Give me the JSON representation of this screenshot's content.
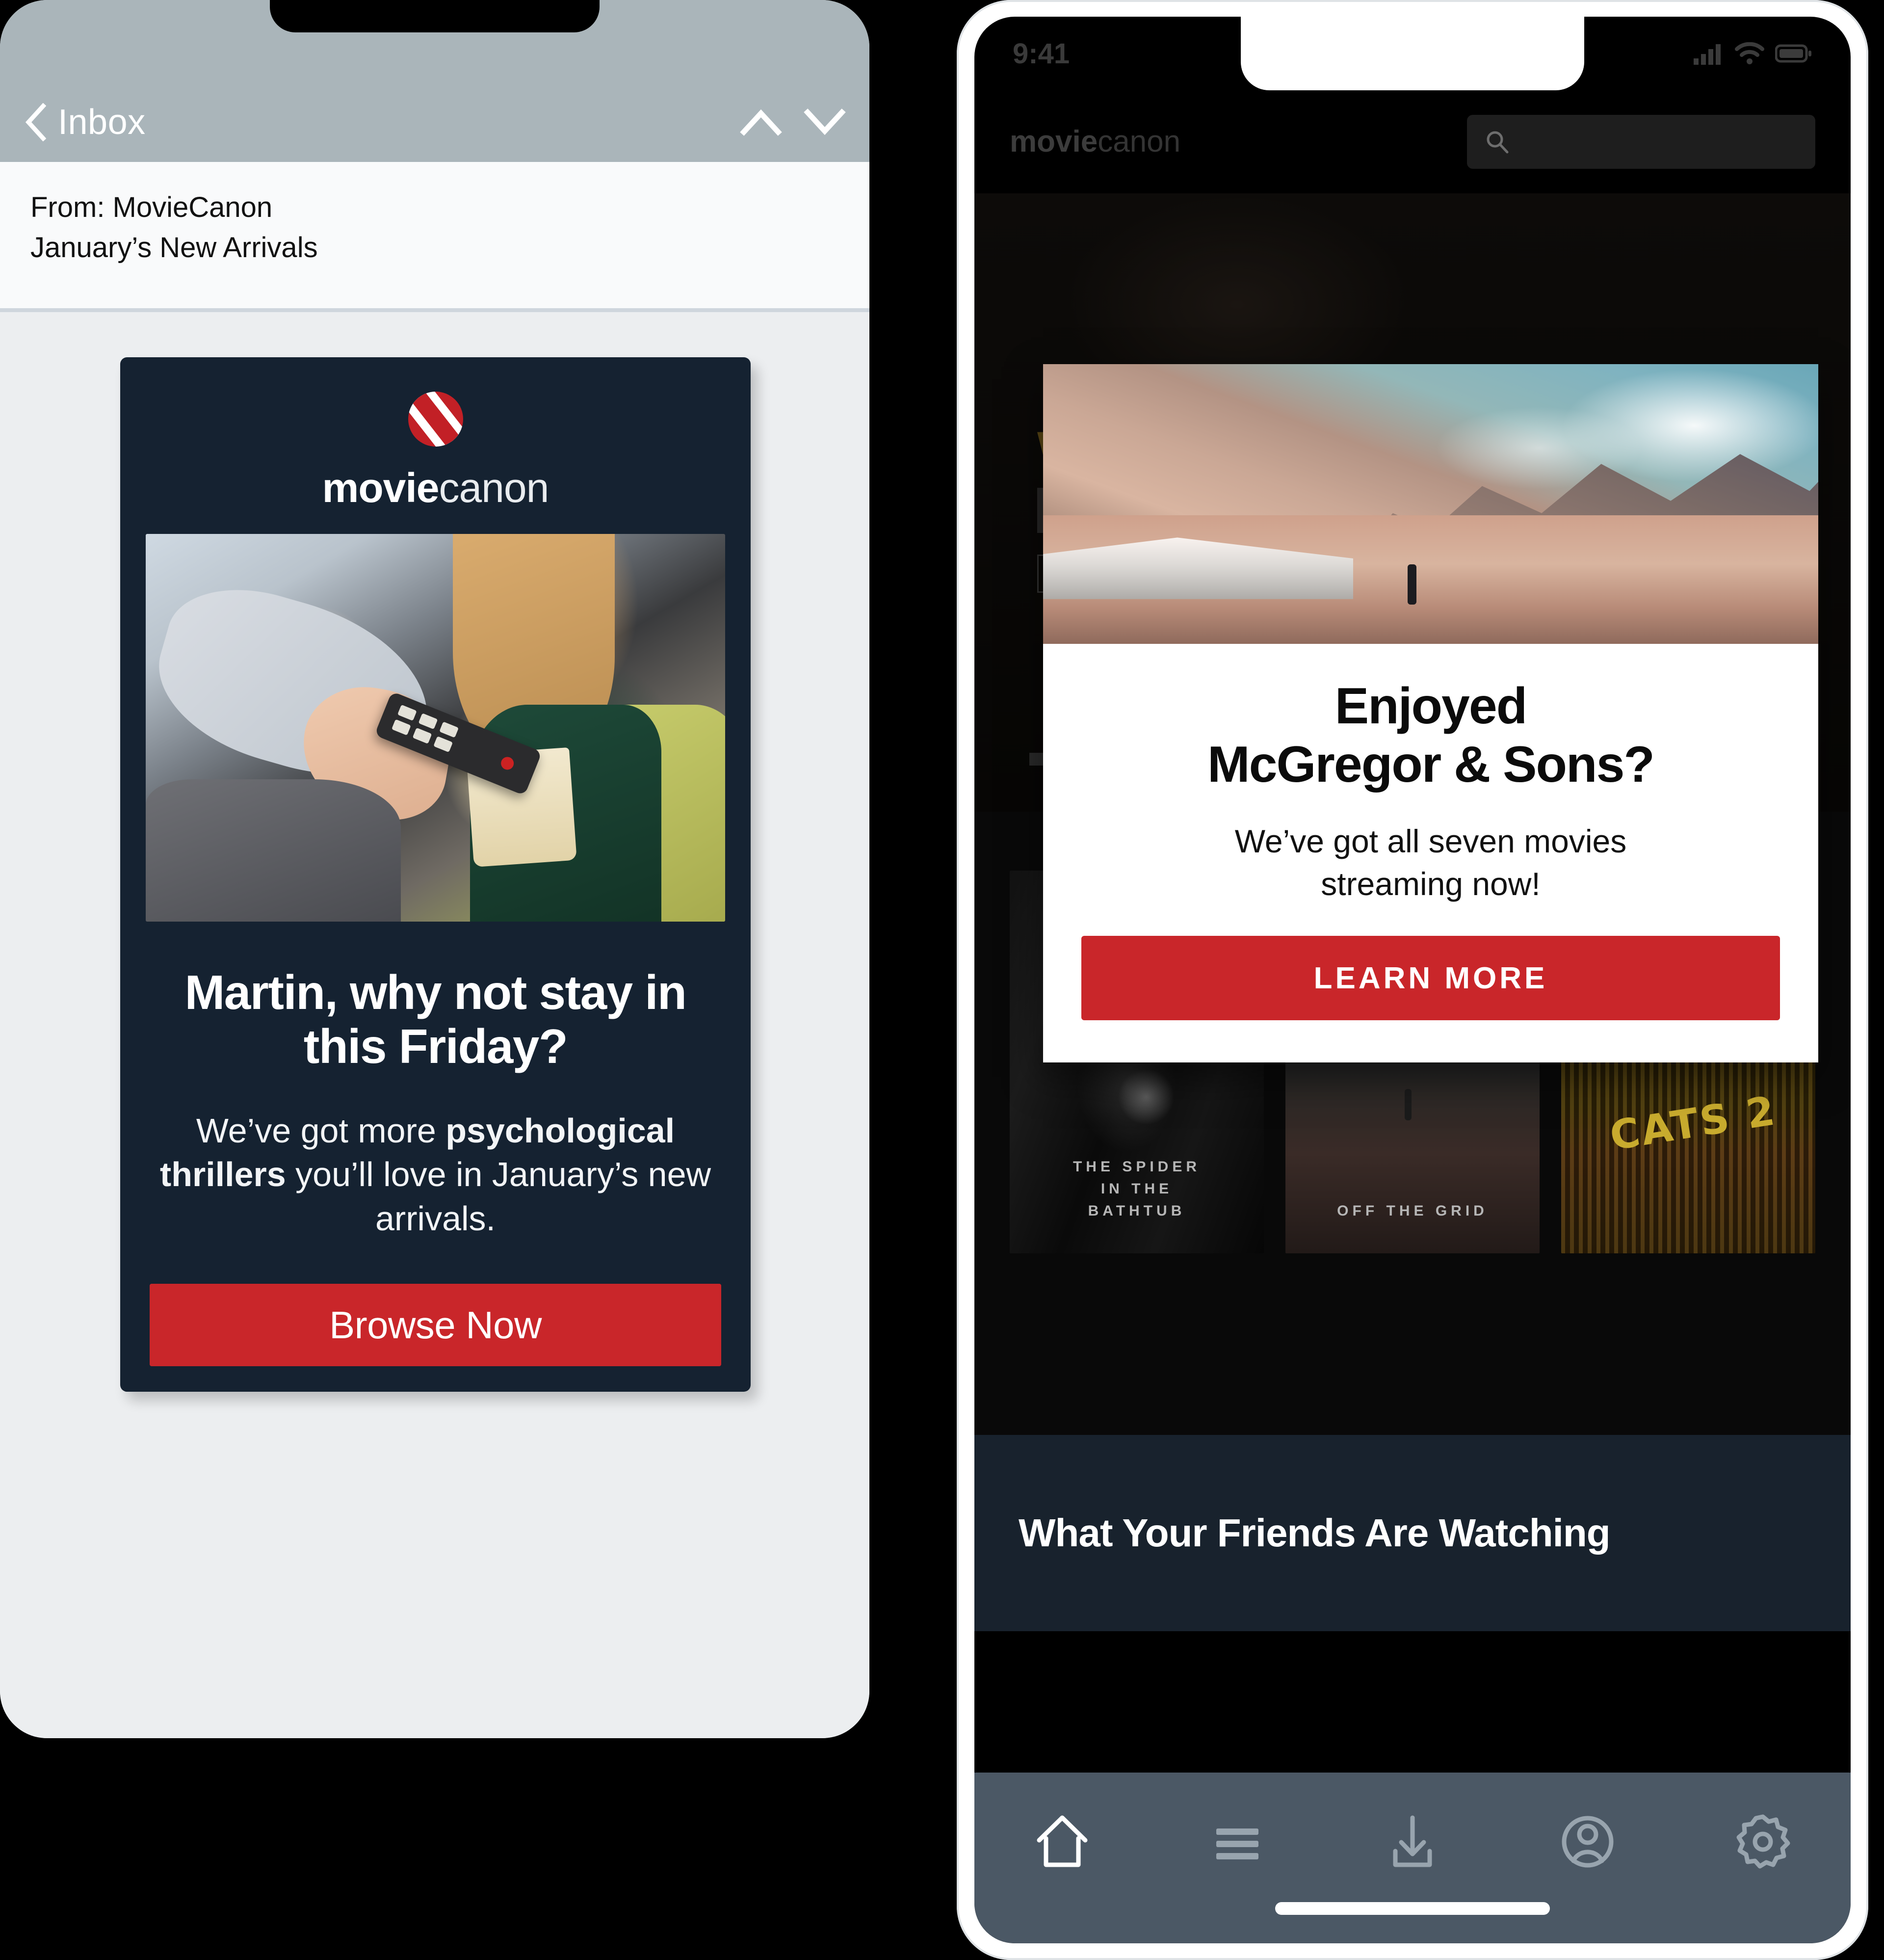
{
  "colors": {
    "brand_red": "#c9262a",
    "email_card_bg": "#152231",
    "mail_topbar": "#aab5ba",
    "tabbar": "#4b5865",
    "friends_strip": "#18222d"
  },
  "email_phone": {
    "topbar": {
      "back_label": "Inbox",
      "back_icon": "chevron-left-icon",
      "prev_icon": "chevron-up-icon",
      "next_icon": "chevron-down-icon"
    },
    "message": {
      "from_line": "From: MovieCanon",
      "subject_line": "January’s New Arrivals"
    },
    "card": {
      "logo_icon": "filmstrip-logo-icon",
      "logo_bold": "movie",
      "logo_light": "canon",
      "hero_alt": "couple-on-couch-with-remote-and-popcorn",
      "headline": "Martin, why not stay in this Friday?",
      "body_before": "We’ve got more ",
      "body_bold": "psychological thrillers",
      "body_after": " you’ll love in January’s new arrivals.",
      "cta_label": "Browse Now"
    }
  },
  "app_phone": {
    "status_bar": {
      "time": "9:41",
      "cellular_icon": "cellular-bars-icon",
      "wifi_icon": "wifi-icon",
      "battery_icon": "battery-icon"
    },
    "header": {
      "logo_bold": "movie",
      "logo_light": "canon",
      "search_icon": "search-icon",
      "search_value": "",
      "search_placeholder": ""
    },
    "background": {
      "banner_title": "W",
      "dimmed": true
    },
    "modal": {
      "hero_alt": "person-walking-on-beach-with-mountains",
      "title_line1": "Enjoyed",
      "title_line2": "McGregor & Sons?",
      "subtitle_line1": "We’ve got all seven movies",
      "subtitle_line2": "streaming now!",
      "cta_label": "LEARN MORE"
    },
    "posters": [
      {
        "title": "THE SPIDER IN THE BATHTUB",
        "lines": [
          "THE SPIDER",
          "IN THE",
          "BATHTUB"
        ]
      },
      {
        "title": "OFF THE GRID",
        "lines": [
          "OFF THE GRID"
        ]
      },
      {
        "title": "CATS 2",
        "lines": [
          "CATS 2"
        ]
      }
    ],
    "section": {
      "title": "What Your Friends Are Watching"
    },
    "tabbar": {
      "items": [
        {
          "name": "home",
          "icon": "home-icon",
          "active": true
        },
        {
          "name": "menu",
          "icon": "hamburger-menu-icon",
          "active": false
        },
        {
          "name": "downloads",
          "icon": "download-icon",
          "active": false
        },
        {
          "name": "profile",
          "icon": "user-profile-icon",
          "active": false
        },
        {
          "name": "settings",
          "icon": "gear-icon",
          "active": false
        }
      ]
    }
  }
}
